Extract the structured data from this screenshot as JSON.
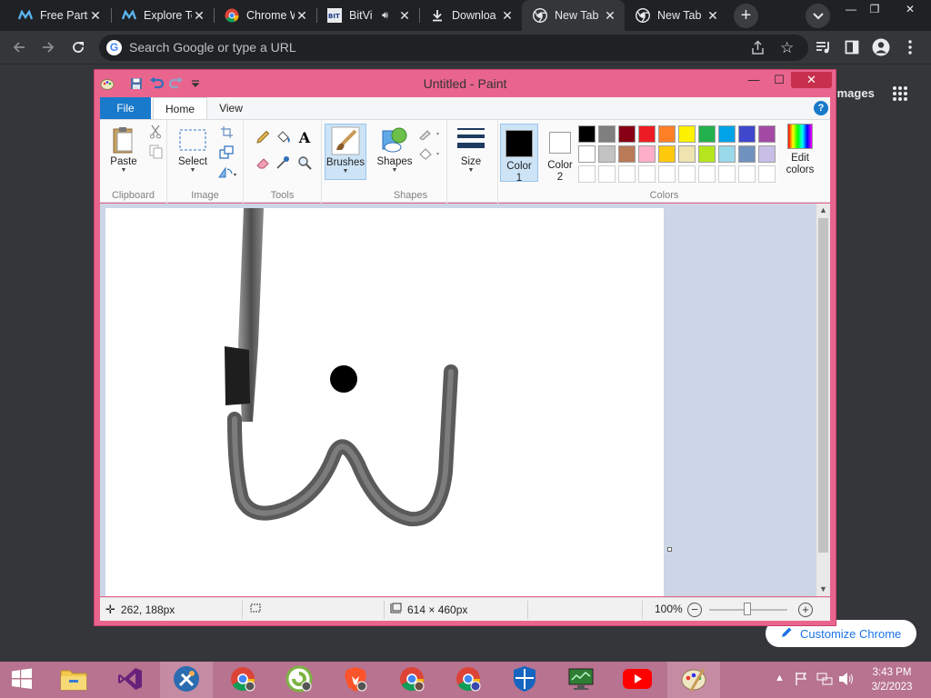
{
  "browser": {
    "tabs": [
      {
        "title": "Free Parts",
        "favicon": "m-logo-icon",
        "active": false
      },
      {
        "title": "Explore Te",
        "favicon": "m-logo-icon",
        "active": false
      },
      {
        "title": "Chrome W",
        "favicon": "chrome-icon",
        "active": false
      },
      {
        "title": "BitVi",
        "favicon": "bitview-icon",
        "active": false
      },
      {
        "title": "Downloa",
        "favicon": "download-icon",
        "active": false
      },
      {
        "title": "New Tab",
        "favicon": "chrome-icon",
        "active": true
      },
      {
        "title": "New Tab",
        "favicon": "chrome-icon",
        "active": false
      }
    ],
    "new_tab_symbol": "+",
    "window_controls": {
      "minimize": "—",
      "restore": "❐",
      "close": "✕"
    },
    "omnibox_placeholder": "Search Google or type a URL",
    "ntp": {
      "images_link": "Images",
      "customize_label": "Customize Chrome"
    }
  },
  "paint": {
    "title": "Untitled - Paint",
    "ribbon_tabs": {
      "file": "File",
      "home": "Home",
      "view": "View"
    },
    "help": "?",
    "groups": {
      "clipboard": {
        "label": "Clipboard",
        "paste": "Paste"
      },
      "image": {
        "label": "Image",
        "select": "Select"
      },
      "tools": {
        "label": "Tools"
      },
      "brushes": {
        "label": "Brushes"
      },
      "shapes": {
        "label": "Shapes",
        "shapes_btn": "Shapes"
      },
      "size": {
        "label": "Size"
      },
      "colors": {
        "label": "Colors",
        "color1_line1": "Color",
        "color1_line2": "1",
        "color2_line1": "Color",
        "color2_line2": "2",
        "edit_line1": "Edit",
        "edit_line2": "colors",
        "color1_value": "#000000",
        "color2_value": "#ffffff",
        "palette_row1": [
          "#000000",
          "#7f7f7f",
          "#880015",
          "#ed1c24",
          "#ff7f27",
          "#fff200",
          "#22b14c",
          "#00a2e8",
          "#3f48cc",
          "#a349a4"
        ],
        "palette_row2": [
          "#ffffff",
          "#c3c3c3",
          "#b97a57",
          "#ffaec9",
          "#ffc90e",
          "#efe4b0",
          "#b5e61d",
          "#99d9ea",
          "#7092be",
          "#c8bfe7"
        ],
        "palette_row3": [
          "#ffffff",
          "#ffffff",
          "#ffffff",
          "#ffffff",
          "#ffffff",
          "#ffffff",
          "#ffffff",
          "#ffffff",
          "#ffffff",
          "#ffffff"
        ]
      }
    },
    "status": {
      "cursor_pos": "262, 188px",
      "canvas_size": "614 × 460px",
      "zoom": "100%"
    }
  },
  "taskbar": {
    "apps": [
      "windows-start-icon",
      "file-explorer-icon",
      "visual-studio-icon",
      "tools-icon",
      "chrome-profile-icon",
      "ccleaner-icon",
      "brave-icon",
      "chrome-profile-b-icon",
      "chrome-profile-c-icon",
      "defender-icon",
      "monitor-app-icon",
      "youtube-icon",
      "paint-icon"
    ],
    "time": "3:43 PM",
    "date": "3/2/2023"
  }
}
